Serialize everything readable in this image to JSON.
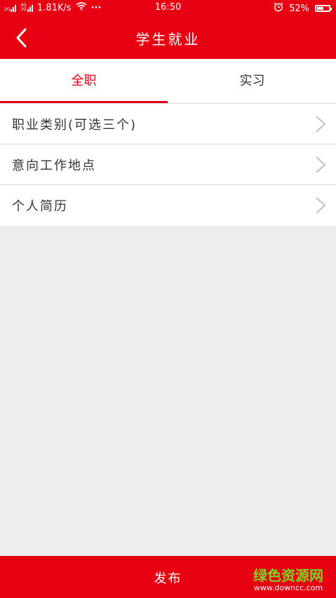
{
  "status_bar": {
    "net1": "2G",
    "net2a": "4G",
    "net2b": "2G",
    "speed": "1.81K/s",
    "more": "···",
    "time": "16:50",
    "battery_percent": "52%",
    "battery_level": 0.52
  },
  "nav": {
    "title": "学生就业"
  },
  "tabs": [
    {
      "label": "全职",
      "active": true
    },
    {
      "label": "实习",
      "active": false
    }
  ],
  "list": {
    "items": [
      {
        "label": "职业类别(可选三个)"
      },
      {
        "label": "意向工作地点"
      },
      {
        "label": "个人简历"
      }
    ]
  },
  "bottom": {
    "publish_label": "发布"
  },
  "watermark": {
    "title": "绿色资源网",
    "url": "www.downcc.com"
  },
  "colors": {
    "brand": "#e60012",
    "background": "#ededed"
  }
}
